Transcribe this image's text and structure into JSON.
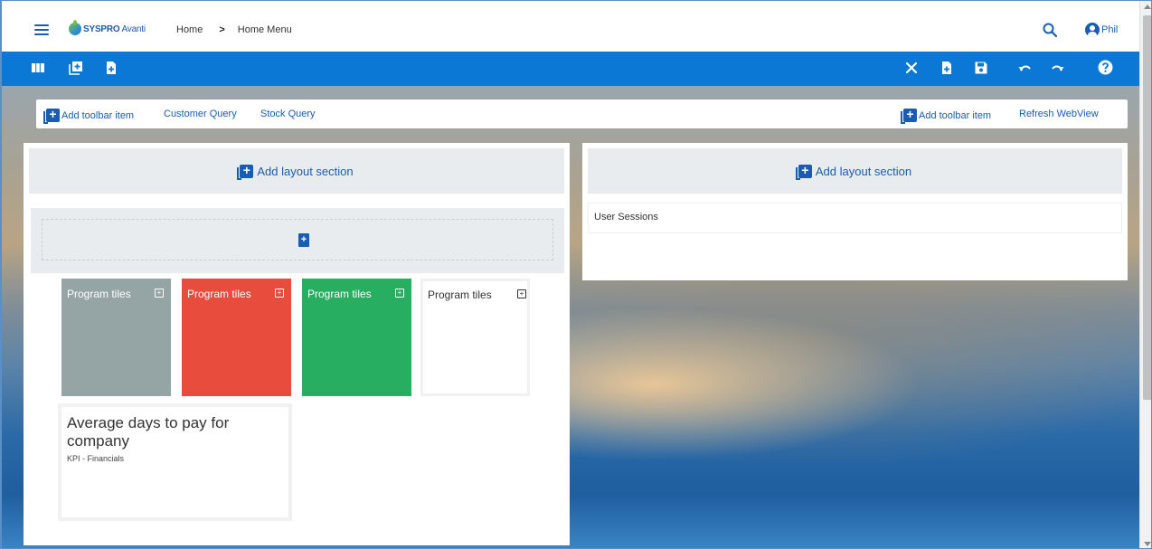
{
  "header": {
    "logo_text": "SYSPRO",
    "logo_sub": "Avanti",
    "breadcrumb": [
      "Home",
      "Home Menu"
    ],
    "breadcrumb_separator": ">",
    "user_name": "Phil"
  },
  "actionbar": {
    "left_icons": [
      "columns-icon",
      "add-panel-icon",
      "add-document-icon"
    ],
    "right_icons": [
      "close-icon",
      "add-document-icon",
      "save-icon",
      "undo-icon",
      "redo-icon",
      "help-icon"
    ]
  },
  "toolbar": {
    "left_add_label": "Add toolbar item",
    "items": [
      "Customer Query",
      "Stock Query"
    ],
    "right_add_label": "Add toolbar item",
    "refresh_label": "Refresh WebView"
  },
  "left_panel": {
    "add_section_label": "Add layout section",
    "tiles": [
      {
        "label": "Program tiles",
        "color": "#95a5a6"
      },
      {
        "label": "Program tiles",
        "color": "#e74c3c"
      },
      {
        "label": "Program tiles",
        "color": "#27ae60"
      },
      {
        "label": "Program tiles",
        "color": "#ffffff"
      }
    ],
    "kpi": {
      "title": "Average days to pay for company",
      "subtitle": "KPI - Financials"
    }
  },
  "right_panel": {
    "add_section_label": "Add layout section",
    "widget_title": "User Sessions"
  },
  "colors": {
    "primary": "#0a78d4",
    "link": "#1a5cb0",
    "section_bg": "#e9ecef"
  }
}
